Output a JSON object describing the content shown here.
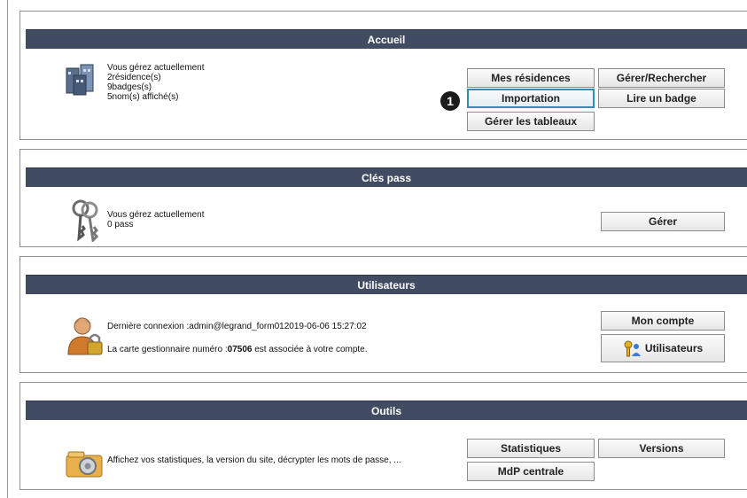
{
  "accueil": {
    "title": "Accueil",
    "line1": "Vous gérez actuellement",
    "line2": "2résidence(s)",
    "line3": "9badges(s)",
    "line4": "5nom(s) affiché(s)",
    "buttons": {
      "mes_residences": "Mes résidences",
      "gerer_rechercher": "Gérer/Rechercher",
      "importation": "Importation",
      "lire_badge": "Lire un badge",
      "gerer_tableaux": "Gérer les tableaux"
    },
    "callout_number": "1"
  },
  "cles_pass": {
    "title": "Clés pass",
    "line1": "Vous gérez actuellement",
    "line2": "0 pass",
    "buttons": {
      "gerer": "Gérer"
    }
  },
  "utilisateurs": {
    "title": "Utilisateurs",
    "last_login": "Dernière connexion :admin@legrand_form012019-06-06 15:27:02",
    "card_prefix": "La carte gestionnaire numéro :",
    "card_number": "07506",
    "card_suffix": " est associée à votre compte.",
    "buttons": {
      "mon_compte": "Mon compte",
      "utilisateurs": "Utilisateurs"
    }
  },
  "outils": {
    "title": "Outils",
    "description": "Affichez vos statistiques, la version du site, décrypter les mots de passe, ...",
    "buttons": {
      "statistiques": "Statistiques",
      "versions": "Versions",
      "mdp_centrale": "MdP centrale"
    }
  },
  "colors": {
    "header_bg": "#414b62",
    "focus_border": "#2f8fb0",
    "button_border": "#8c8c8c"
  }
}
